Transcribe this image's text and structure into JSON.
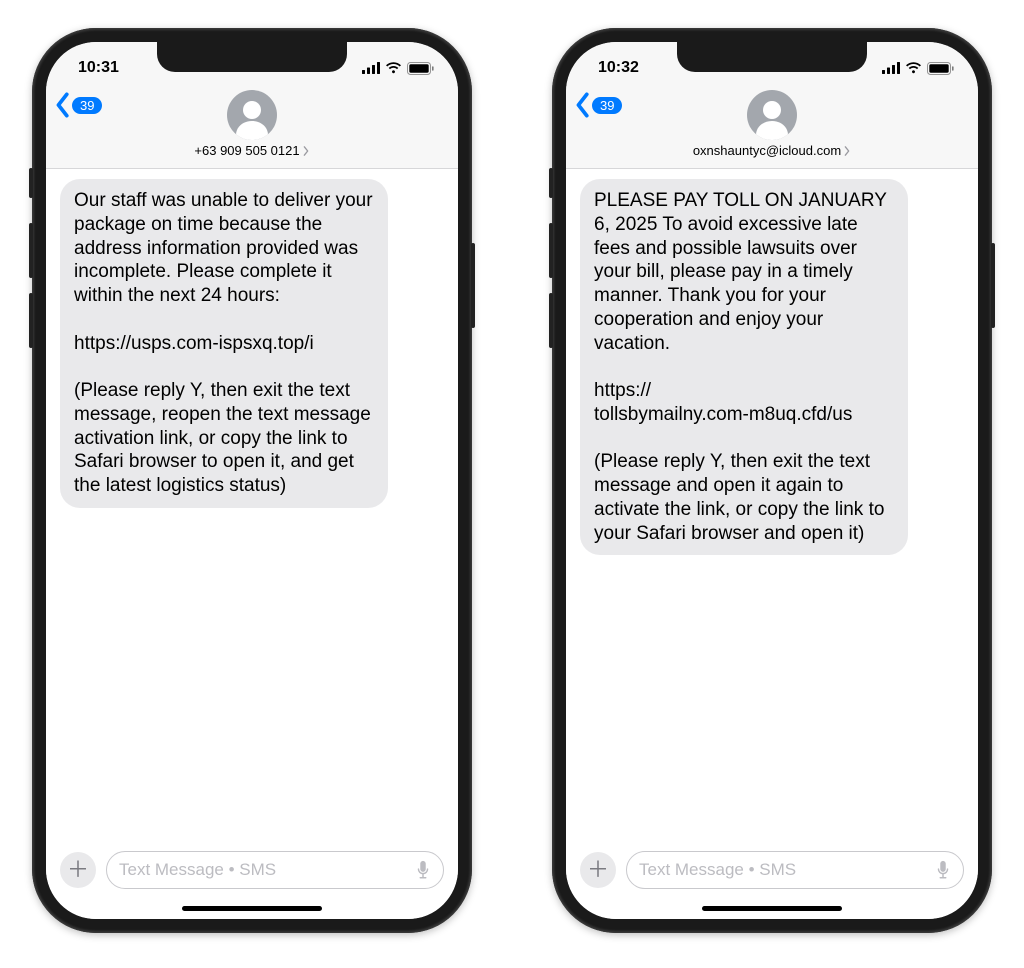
{
  "phones": [
    {
      "time": "10:31",
      "back_count": "39",
      "contact": "+63 909 505 0121",
      "placeholder": "Text Message • SMS",
      "message": "Our staff was unable to deliver your\npackage on time because the\naddress information provided was incomplete. Please complete it\nwithin the next 24 hours:\n\nhttps://usps.com-ispsxq.top/i\n\n(Please reply Y, then exit the text message, reopen the text message activation link, or copy the link to Safari browser to open it, and get the latest logistics status)"
    },
    {
      "time": "10:32",
      "back_count": "39",
      "contact": "oxnshauntyc@icloud.com",
      "placeholder": "Text Message • SMS",
      "message": "PLEASE PAY TOLL ON JANUARY 6, 2025 To avoid excessive late fees and possible lawsuits over your bill, please pay in a timely manner. Thank you for your cooperation and enjoy your vacation.\n\nhttps://\ntollsbymailny.com-m8uq.cfd/us\n\n(Please reply Y, then exit the text message and open it again to activate the link, or copy the link to your Safari browser and open it)"
    }
  ]
}
